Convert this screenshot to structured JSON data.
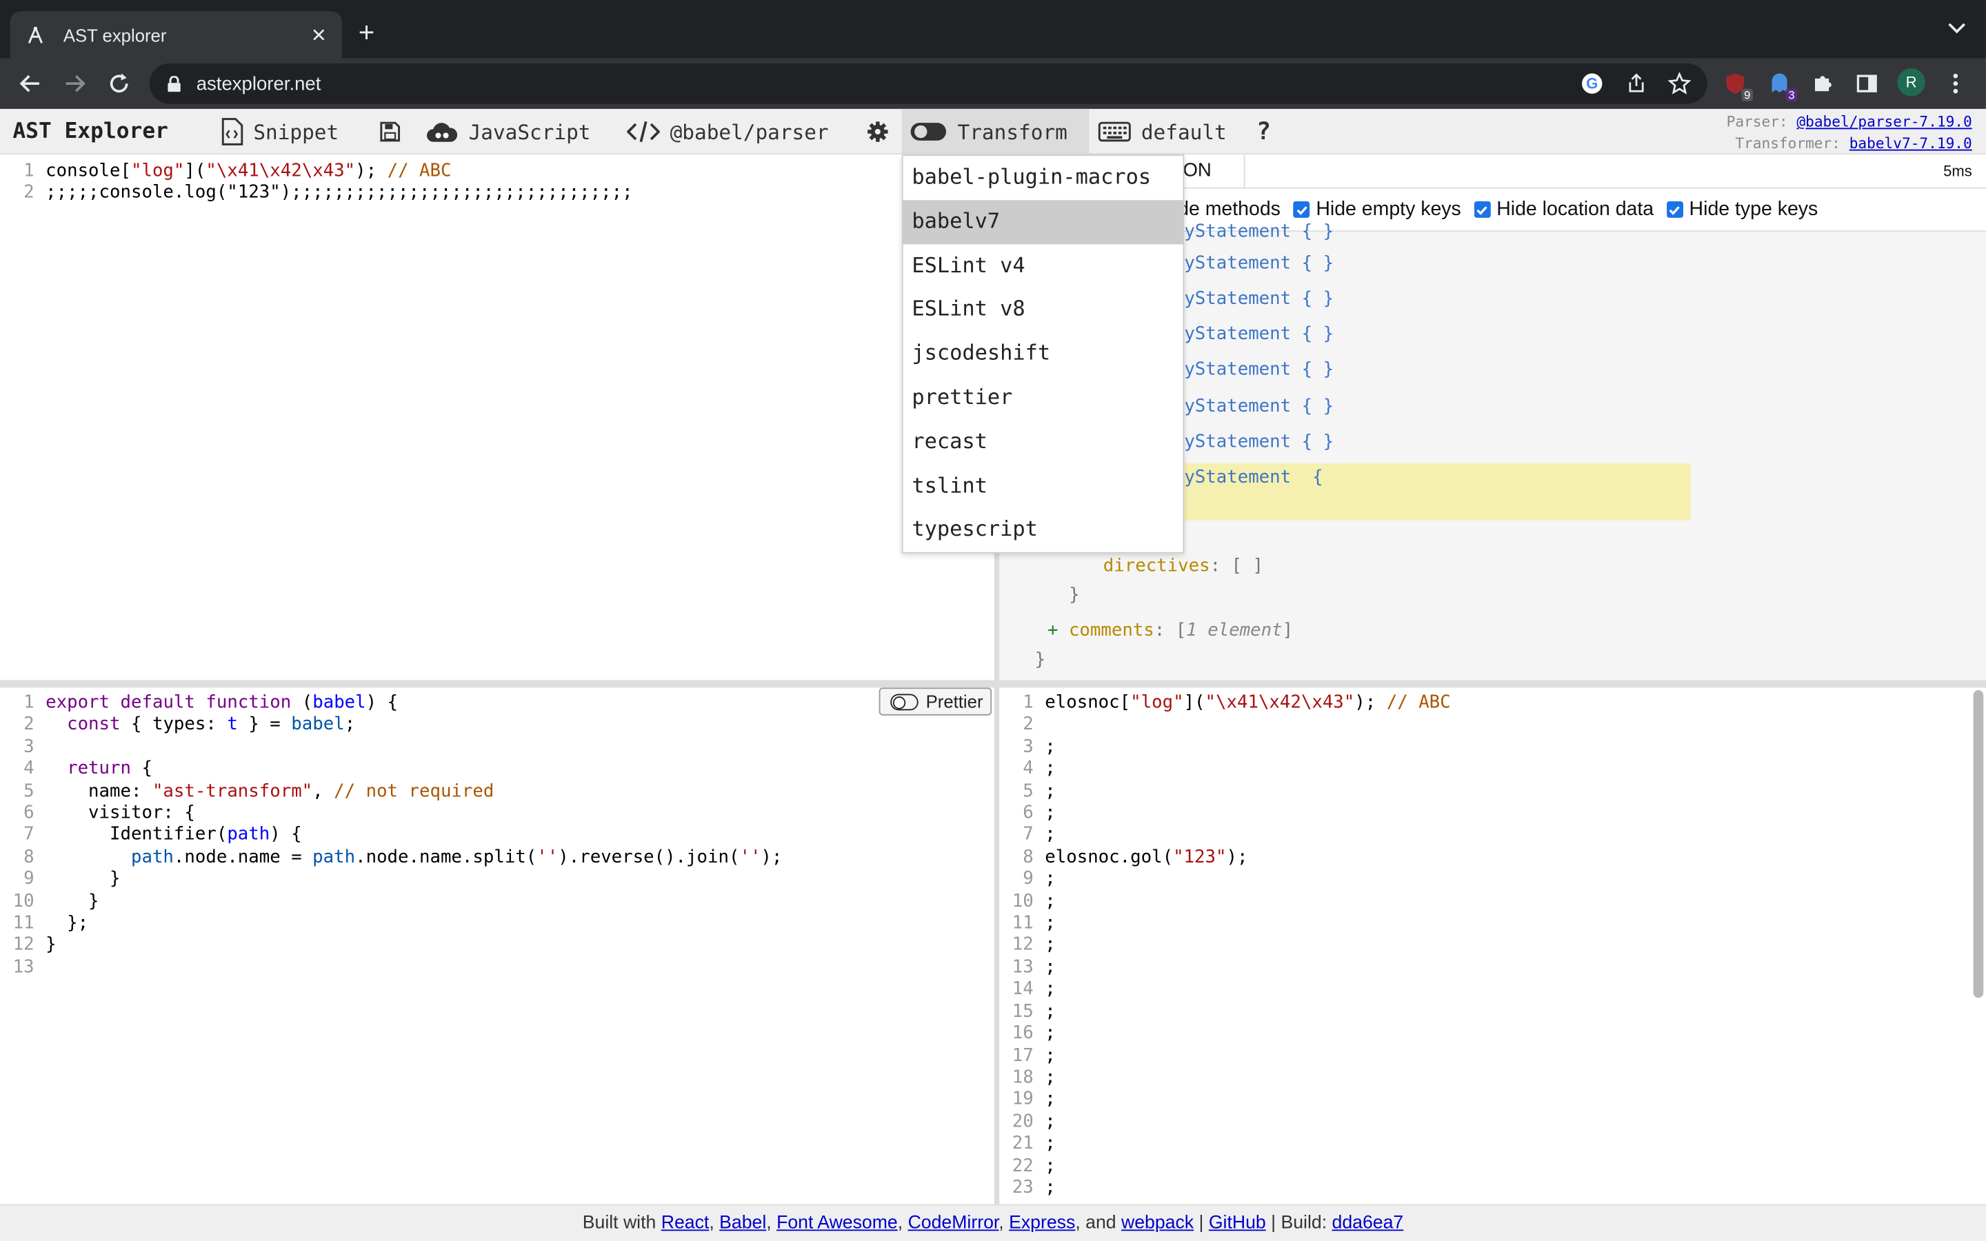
{
  "browser": {
    "tab_title": "AST explorer",
    "tab_close": "✕",
    "new_tab": "+",
    "url": "astexplorer.net",
    "profile_initial": "R",
    "ext_badges": [
      "9",
      "3"
    ]
  },
  "appbar": {
    "brand": "AST Explorer",
    "snippet": "Snippet",
    "language": "JavaScript",
    "parser": "@babel/parser",
    "transform": "Transform",
    "keymap": "default",
    "help": "?",
    "parser_label": "Parser:",
    "parser_link": "@babel/parser-7.19.0",
    "transformer_label": "Transformer:",
    "transformer_link": "babelv7-7.19.0"
  },
  "source_editor": {
    "lines": [
      "console[\"log\"](\"\\x41\\x42\\x43\"); // ABC",
      ";;;;;console.log(\"123\");;;;;;;;;;;;;;;;;;;;;;;;;;;;;;;;"
    ]
  },
  "ast_panel": {
    "json_tab": "ON",
    "timing": "5ms",
    "options": [
      "de methods",
      "Hide empty keys",
      "Hide location data",
      "Hide type keys"
    ],
    "rows": [
      "yStatement { }",
      "yStatement { }",
      "yStatement { }",
      "yStatement { }",
      "yStatement { }",
      "yStatement { }",
      "yStatement { }",
      "yStatement  {"
    ],
    "directives_key": "directives",
    "directives_val": "[ ]",
    "close_brace": "}",
    "comments_plus": "+",
    "comments_key": "comments",
    "comments_val": "1 element",
    "root_close": "}"
  },
  "transform_editor": {
    "prettier_label": "Prettier",
    "line_count": 13
  },
  "output_editor": {
    "line1": "elosnoc[\"log\"](\"\\x41\\x42\\x43\"); // ABC",
    "line8": "elosnoc.gol(\"123\");",
    "semicolon": ";"
  },
  "dropdown": {
    "items": [
      "babel-plugin-macros",
      "babelv7",
      "ESLint v4",
      "ESLint v8",
      "jscodeshift",
      "prettier",
      "recast",
      "tslint",
      "typescript"
    ],
    "selected": "babelv7"
  },
  "footer": {
    "prefix": "Built with",
    "links": [
      "React",
      "Babel",
      "Font Awesome",
      "CodeMirror",
      "Express",
      "webpack"
    ],
    "and": "and",
    "github": "GitHub",
    "build_label": "Build:",
    "build_hash": "dda6ea7"
  },
  "colors": {
    "chrome_dark": "#202124",
    "chrome_tab": "#35363a",
    "highlight": "#f5f0b0",
    "checkbox": "#1a73e8"
  }
}
